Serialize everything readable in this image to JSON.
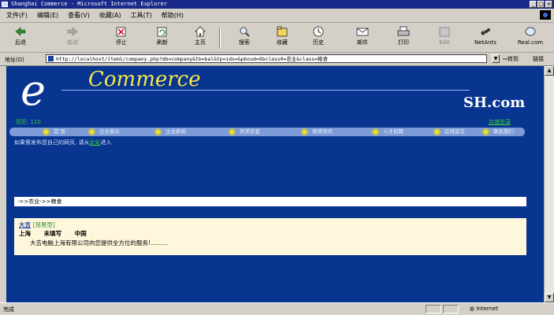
{
  "window": {
    "title": "Shanghai Commerce - Microsoft Internet Explorer",
    "controls": [
      "_",
      "□",
      "×"
    ]
  },
  "menu": {
    "items": [
      "文件(F)",
      "编辑(E)",
      "查看(V)",
      "收藏(A)",
      "工具(T)",
      "帮助(H)"
    ]
  },
  "toolbar": {
    "back": "后退",
    "forward": "前进",
    "stop": "停止",
    "refresh": "刷新",
    "home": "主页",
    "search": "搜索",
    "favorites": "收藏",
    "history": "历史",
    "mail": "邮件",
    "print": "打印",
    "edit": "Edit",
    "netants": "NetAnts",
    "realcom": "Real.com"
  },
  "address": {
    "label": "地址(D)",
    "url": "http://localhost/item1/company.php?db=company&tb=bal&tp=idx=&pboud=Obclass0=农业&class=粮食",
    "go": "转到",
    "links": "链接"
  },
  "page": {
    "logo_e": "e",
    "logo_commerce": "Commerce",
    "logo_sh": "SH.com",
    "visitors": "您好, 110",
    "enter_link": "店铺登录",
    "nav": [
      "首 页",
      "企业展示",
      "企业新闻",
      "供求信息",
      "商情快讯",
      "人才招聘",
      "在线留言",
      "联系我们"
    ],
    "notice_prefix": "如果需发布您自己的网页, 请从",
    "notice_link": "此处",
    "notice_suffix": "进入",
    "breadcrumb": "->>农业->>粮食",
    "company": {
      "name": "大吉",
      "type": "[贸易型]",
      "city": "上海",
      "field2": "未填写",
      "country": "中国",
      "description": "大吉电脑上海有限公司向您提供全方位的服务!........."
    }
  },
  "status": {
    "text": "完成",
    "zone": "Internet"
  }
}
